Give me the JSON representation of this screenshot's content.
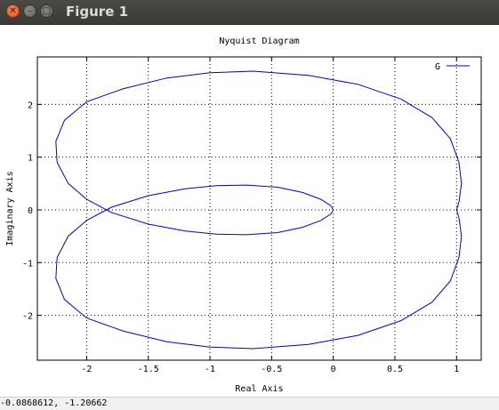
{
  "window": {
    "title": "Figure 1",
    "close_icon": "close-icon",
    "minimize_icon": "minimize-icon",
    "maximize_icon": "maximize-icon"
  },
  "status": {
    "coordinates": "-0.0868612, -1.20662"
  },
  "chart_data": {
    "type": "line",
    "title": "Nyquist Diagram",
    "xlabel": "Real Axis",
    "ylabel": "Imaginary Axis",
    "xlim": [
      -2.4,
      1.2
    ],
    "ylim": [
      -2.85,
      2.9
    ],
    "xticks": [
      -2,
      -1.5,
      -1,
      -0.5,
      0,
      0.5,
      1
    ],
    "xtick_labels": [
      "-2",
      "-1.5",
      "-1",
      "-0.5",
      "0",
      "0.5",
      "1"
    ],
    "yticks": [
      -2,
      -1,
      0,
      1,
      2
    ],
    "ytick_labels": [
      "-2",
      "-1",
      "0",
      "1",
      "2"
    ],
    "grid": true,
    "legend_position": "top-right",
    "series_color": "#0000cc",
    "series": [
      {
        "name": "G",
        "x": [
          0,
          -0.02,
          -0.1,
          -0.25,
          -0.45,
          -0.7,
          -0.95,
          -1.2,
          -1.5,
          -1.8,
          -2.0,
          -2.15,
          -2.24,
          -2.25,
          -2.18,
          -2.0,
          -1.7,
          -1.35,
          -1.0,
          -0.65,
          -0.2,
          0.2,
          0.55,
          0.8,
          0.95,
          1.02,
          1.04,
          1.02,
          1.0,
          1.02,
          1.04,
          1.02,
          0.95,
          0.8,
          0.55,
          0.2,
          -0.2,
          -0.65,
          -1.0,
          -1.35,
          -1.7,
          -2.0,
          -2.18,
          -2.25,
          -2.24,
          -2.15,
          -2.0,
          -1.8,
          -1.5,
          -1.2,
          -0.95,
          -0.7,
          -0.45,
          -0.25,
          -0.1,
          -0.02,
          0
        ],
        "y": [
          0,
          0.08,
          0.2,
          0.33,
          0.43,
          0.47,
          0.46,
          0.4,
          0.27,
          0.05,
          -0.2,
          -0.5,
          -0.9,
          -1.3,
          -1.7,
          -2.05,
          -2.3,
          -2.5,
          -2.6,
          -2.63,
          -2.55,
          -2.38,
          -2.1,
          -1.75,
          -1.35,
          -0.9,
          -0.5,
          -0.15,
          0,
          0.15,
          0.5,
          0.9,
          1.35,
          1.75,
          2.1,
          2.38,
          2.55,
          2.63,
          2.6,
          2.5,
          2.3,
          2.05,
          1.7,
          1.3,
          0.9,
          0.5,
          0.2,
          -0.05,
          -0.27,
          -0.4,
          -0.46,
          -0.47,
          -0.43,
          -0.33,
          -0.2,
          -0.08,
          0
        ]
      }
    ]
  }
}
